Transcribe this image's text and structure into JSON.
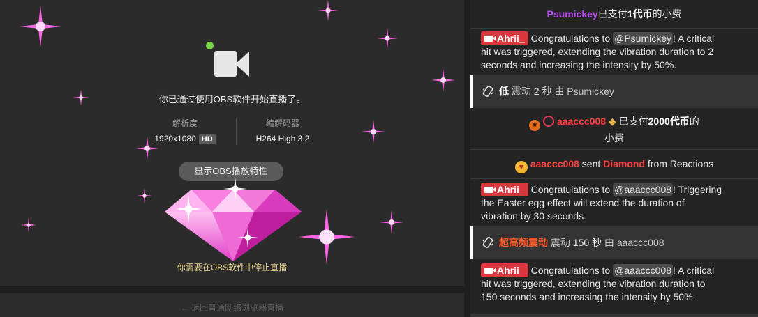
{
  "stream": {
    "status_text": "你已通过使用OBS软件开始直播了。",
    "resolution_label": "解析度",
    "resolution_value": "1920x1080",
    "resolution_badge": "HD",
    "encoder_label": "编解码器",
    "encoder_value": "H264 High 3.2",
    "obs_button": "显示OBS播放特性",
    "stop_note": "你需要在OBS软件中停止直播",
    "back_link": "返回普通网络浏览器直播",
    "live_color": "#7bd64a"
  },
  "chat": {
    "tip1": {
      "user": "Psumickey",
      "text_a": "已支付",
      "amount": "1代币",
      "text_b": "的小费"
    },
    "bot1": {
      "name": "Ahrii_",
      "pre": "Congratulations to ",
      "mention": "@Psumickey",
      "line1_rest": "! A critical",
      "line2": "hit was triggered, extending the vibration duration to 2",
      "line3": "seconds and increasing the intensity by 50%."
    },
    "vib1": {
      "level": "低",
      "label": "震动",
      "duration": "2 秒",
      "by": "由",
      "user": "Psumickey"
    },
    "tip2": {
      "user": "aaaccc008",
      "text_a": "已支付",
      "amount": "2000代币",
      "text_b": "的",
      "line2": "小费"
    },
    "reaction": {
      "user": "aaaccc008",
      "sent": "sent",
      "gift": "Diamond",
      "from": "from Reactions"
    },
    "bot2": {
      "name": "Ahrii_",
      "pre": "Congratulations to ",
      "mention": "@aaaccc008",
      "line1_rest": "! Triggering",
      "line2": "the Easter egg effect will extend the duration of",
      "line3": "vibration by 30 seconds."
    },
    "vib2": {
      "level": "超高频震动",
      "label": "震动",
      "duration": "150 秒",
      "by": "由",
      "user": "aaaccc008"
    },
    "bot3": {
      "name": "Ahrii_",
      "pre": "Congratulations to ",
      "mention": "@aaaccc008",
      "line1_rest": "! A critical",
      "line2": "hit was triggered, extending the vibration duration to",
      "line3": "150 seconds and increasing the intensity by 50%."
    }
  },
  "icons": [
    "camera-icon",
    "video-icon",
    "vibrate-icon",
    "star-badge-icon",
    "diamond-badge-icon",
    "shield-icon",
    "heart-eyes-emoji",
    "arrow-left-icon"
  ]
}
